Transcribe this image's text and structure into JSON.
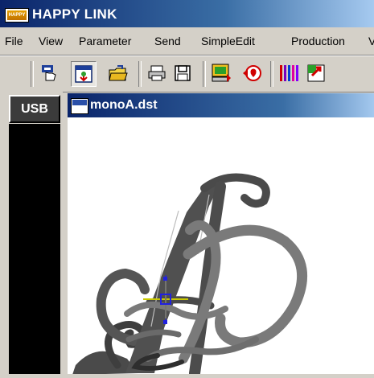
{
  "app": {
    "title": "HAPPY LINK",
    "logo_text": "HAPPY"
  },
  "menu": [
    "File",
    "View",
    "Parameter",
    "Send",
    "SimpleEdit",
    "Production"
  ],
  "toolbar": {
    "buttons": [
      "hand-pointer-icon",
      "design-view-icon",
      "open-folder-icon",
      "print-icon",
      "save-icon",
      "send-to-machine-icon",
      "receive-design-icon",
      "color-threads-icon",
      "convert-icon"
    ]
  },
  "sidebar": {
    "usb_label": "USB"
  },
  "document": {
    "title": "monoA.dst",
    "icon_text": "HAPPY"
  },
  "colors": {
    "titlebar": "#0a246a",
    "stitch_dark": "#4a4a4a",
    "stitch_light": "#7a7a7a",
    "crosshair": "#c8c800",
    "cursor": "#2020e0"
  }
}
